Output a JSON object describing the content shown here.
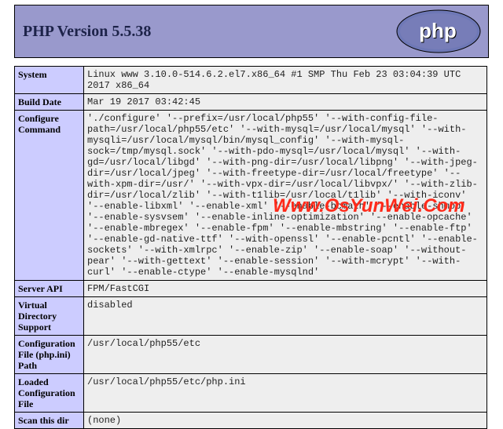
{
  "header": {
    "title": "PHP Version 5.5.38",
    "logo_text": "php"
  },
  "watermark": "Www.OsYunWei.Com",
  "rows": [
    {
      "key": "System",
      "val": "Linux www 3.10.0-514.6.2.el7.x86_64 #1 SMP Thu Feb 23 03:04:39 UTC 2017 x86_64"
    },
    {
      "key": "Build Date",
      "val": "Mar 19 2017 03:42:45"
    },
    {
      "key": "Configure Command",
      "val": "'./configure' '--prefix=/usr/local/php55' '--with-config-file-path=/usr/local/php55/etc' '--with-mysql=/usr/local/mysql' '--with-mysqli=/usr/local/mysql/bin/mysql_config' '--with-mysql-sock=/tmp/mysql.sock' '--with-pdo-mysql=/usr/local/mysql' '--with-gd=/usr/local/libgd' '--with-png-dir=/usr/local/libpng' '--with-jpeg-dir=/usr/local/jpeg' '--with-freetype-dir=/usr/local/freetype' '--with-xpm-dir=/usr/' '--with-vpx-dir=/usr/local/libvpx/' '--with-zlib-dir=/usr/local/zlib' '--with-t1lib=/usr/local/t1lib' '--with-iconv' '--enable-libxml' '--enable-xml' '--enable-bcmath' '--enable-shmop' '--enable-sysvsem' '--enable-inline-optimization' '--enable-opcache' '--enable-mbregex' '--enable-fpm' '--enable-mbstring' '--enable-ftp' '--enable-gd-native-ttf' '--with-openssl' '--enable-pcntl' '--enable-sockets' '--with-xmlrpc' '--enable-zip' '--enable-soap' '--without-pear' '--with-gettext' '--enable-session' '--with-mcrypt' '--with-curl' '--enable-ctype' '--enable-mysqlnd'"
    },
    {
      "key": "Server API",
      "val": "FPM/FastCGI"
    },
    {
      "key": "Virtual Directory Support",
      "val": "disabled"
    },
    {
      "key": "Configuration File (php.ini) Path",
      "val": "/usr/local/php55/etc"
    },
    {
      "key": "Loaded Configuration File",
      "val": "/usr/local/php55/etc/php.ini"
    },
    {
      "key": "Scan this dir",
      "val": "(none)"
    }
  ]
}
